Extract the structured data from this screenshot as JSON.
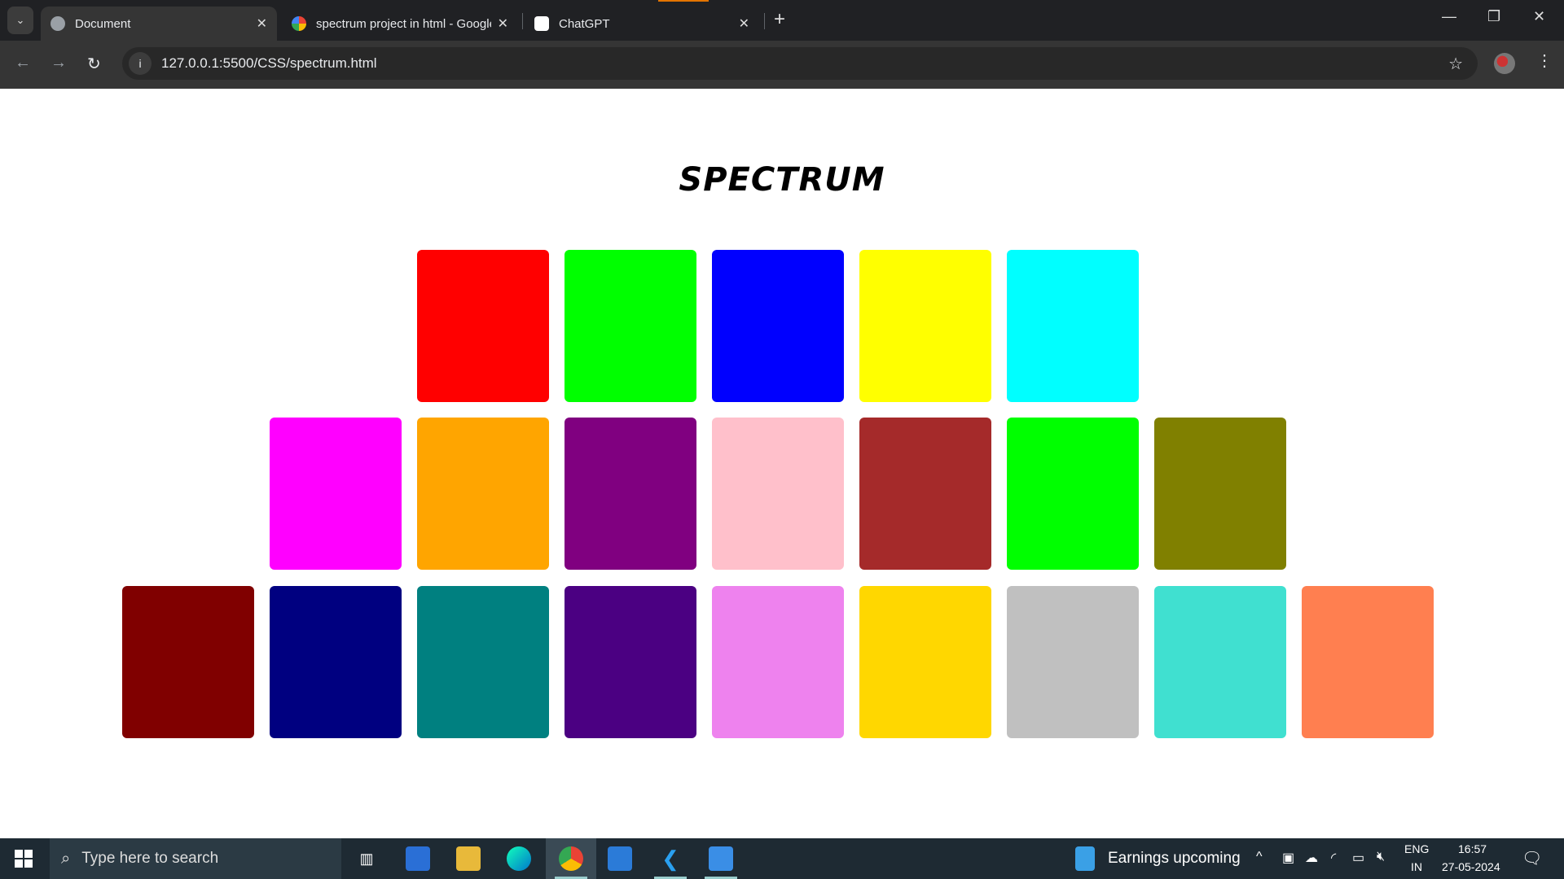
{
  "browser": {
    "tabs": [
      {
        "title": "Document",
        "icon": "globe-icon",
        "active": true
      },
      {
        "title": "spectrum project in html - Google",
        "icon": "google-icon",
        "active": false
      },
      {
        "title": "ChatGPT",
        "icon": "chatgpt-icon",
        "active": false
      }
    ],
    "new_tab": "+",
    "url": "127.0.0.1:5500/CSS/spectrum.html"
  },
  "page": {
    "title": "SPECTRUM",
    "rows": [
      [
        "#ff0000",
        "#00ff00",
        "#0000ff",
        "#ffff00",
        "#00ffff"
      ],
      [
        "#ff00ff",
        "#ffa500",
        "#800080",
        "#ffc0cb",
        "#a52a2a",
        "#00ff00",
        "#808000"
      ],
      [
        "#800000",
        "#000080",
        "#008080",
        "#4b0082",
        "#ee82ee",
        "#ffd700",
        "#c0c0c0",
        "#40e0d0",
        "#ff7f50"
      ]
    ]
  },
  "taskbar": {
    "search_placeholder": "Type here to search",
    "news": "Earnings upcoming",
    "lang": "ENG",
    "region": "IN",
    "time": "16:57",
    "date": "27-05-2024"
  }
}
